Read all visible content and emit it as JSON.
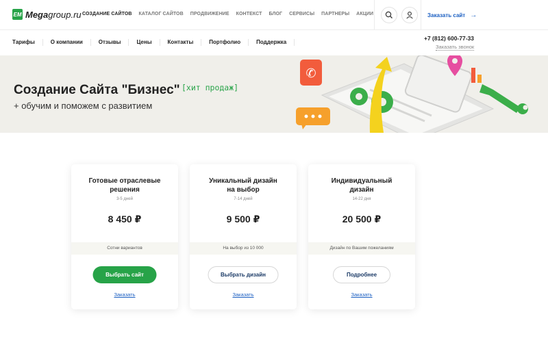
{
  "logo": {
    "mark": "EM",
    "bold": "Mega",
    "rest": "group.ru"
  },
  "mainnav": [
    "СОЗДАНИЕ САЙТОВ",
    "КАТАЛОГ САЙТОВ",
    "ПРОДВИЖЕНИЕ",
    "КОНТЕКСТ",
    "БЛОГ",
    "СЕРВИСЫ",
    "ПАРТНЕРЫ",
    "АКЦИИ"
  ],
  "header": {
    "order_site": "Заказать сайт",
    "phone": "+7 (812) 600-77-33",
    "callback": "Заказать звонок"
  },
  "icons": {
    "search": "search-icon",
    "user": "user-icon",
    "arrow": "arrow-right-icon"
  },
  "subnav": [
    "Тарифы",
    "О компании",
    "Отзывы",
    "Цены",
    "Контакты",
    "Портфолио",
    "Поддержка"
  ],
  "banner": {
    "title": "Создание Сайта \"Бизнес\"",
    "badge": "[хит продаж]",
    "subtitle": "+ обучим и поможем с развитием"
  },
  "cards": [
    {
      "title_line1": "Готовые отраслевые",
      "title_line2": "решения",
      "days": "3-5 дней",
      "price": "8 450 ₽",
      "note": "Сотни вариантов",
      "button": "Выбрать сайт",
      "link": "Заказать"
    },
    {
      "title_line1": "Уникальный дизайн",
      "title_line2": "на выбор",
      "days": "7-14 дней",
      "price": "9 500 ₽",
      "note": "На выбор из 10 000",
      "button": "Выбрать дизайн",
      "link": "Заказать"
    },
    {
      "title_line1": "Индивидуальный",
      "title_line2": "дизайн",
      "days": "14-22 дня",
      "price": "20 500 ₽",
      "note": "Дизайн по Вашим пожеланиям",
      "button": "Подробнее",
      "link": "Заказать"
    }
  ],
  "colors": {
    "accent_green": "#27a348",
    "link_blue": "#1b5fc2",
    "banner_bg": "#f0efea"
  }
}
